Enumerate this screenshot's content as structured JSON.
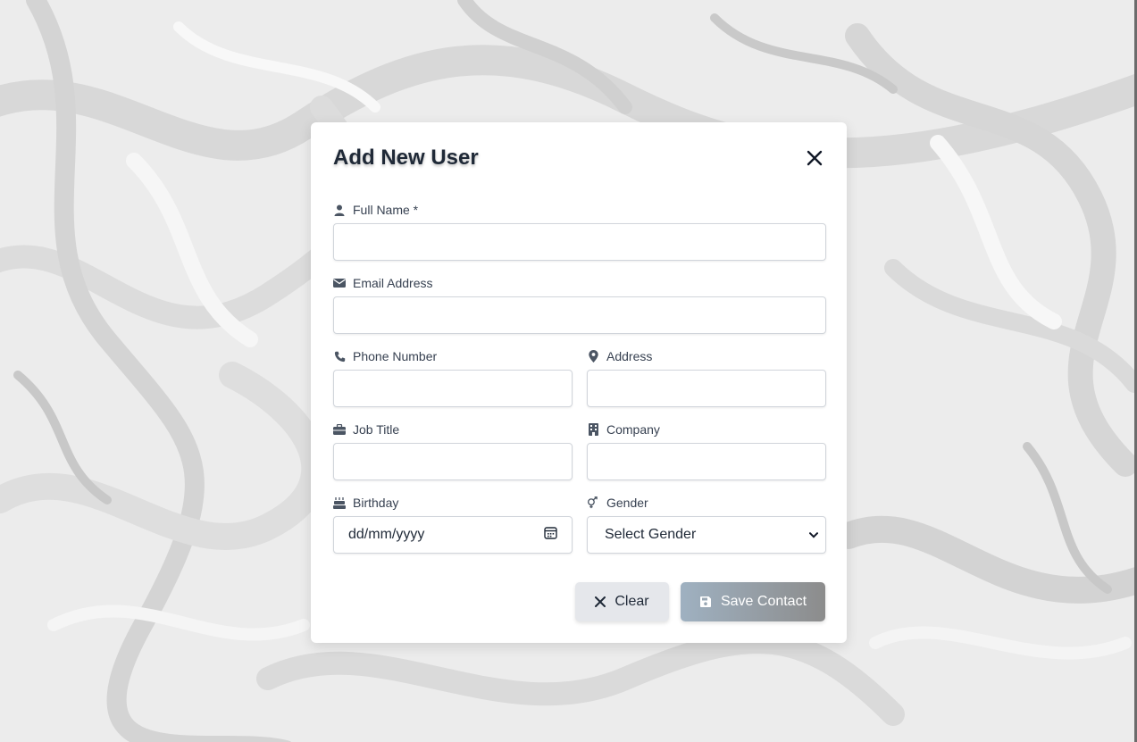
{
  "modal": {
    "title": "Add New User",
    "close_icon": "close-icon"
  },
  "form": {
    "full_name": {
      "label": "Full Name *",
      "icon": "user-icon",
      "value": ""
    },
    "email": {
      "label": "Email Address",
      "icon": "envelope-icon",
      "value": ""
    },
    "phone": {
      "label": "Phone Number",
      "icon": "phone-icon",
      "value": ""
    },
    "address": {
      "label": "Address",
      "icon": "map-pin-icon",
      "value": ""
    },
    "job_title": {
      "label": "Job Title",
      "icon": "briefcase-icon",
      "value": ""
    },
    "company": {
      "label": "Company",
      "icon": "building-icon",
      "value": ""
    },
    "birthday": {
      "label": "Birthday",
      "icon": "cake-icon",
      "placeholder": "dd/mm/yyyy",
      "calendar_icon": "calendar-icon"
    },
    "gender": {
      "label": "Gender",
      "icon": "gender-icon",
      "selected": "Select Gender",
      "chevron_icon": "chevron-down-icon"
    }
  },
  "actions": {
    "clear_label": "Clear",
    "clear_icon": "close-icon",
    "save_label": "Save Contact",
    "save_icon": "save-icon"
  },
  "colors": {
    "background": "#e9e9e9",
    "modal": "#ffffff",
    "title": "#1f2937",
    "clear_button": "#e5e7eb",
    "save_gradient_start": "#9fb1c1",
    "save_gradient_end": "#8c8c8c"
  }
}
